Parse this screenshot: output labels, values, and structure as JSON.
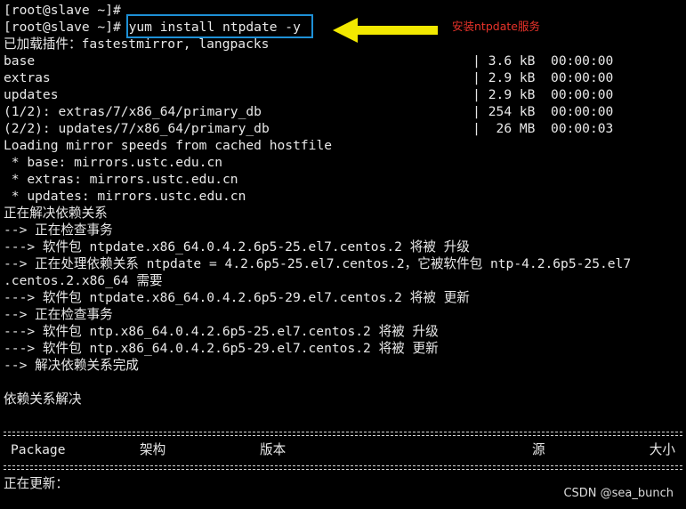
{
  "annotation": {
    "text": "安装ntpdate服务",
    "text_color": "#e8332a",
    "arrow_color": "#f2e800",
    "box_color": "#1e90d6"
  },
  "terminal": {
    "lines": [
      "[root@slave ~]#",
      "[root@slave ~]# yum install ntpdate -y",
      "已加载插件：fastestmirror, langpacks",
      "base                                                        | 3.6 kB  00:00:00",
      "extras                                                      | 2.9 kB  00:00:00",
      "updates                                                     | 2.9 kB  00:00:00",
      "(1/2): extras/7/x86_64/primary_db                           | 254 kB  00:00:00",
      "(2/2): updates/7/x86_64/primary_db                          |  26 MB  00:00:03",
      "Loading mirror speeds from cached hostfile",
      " * base: mirrors.ustc.edu.cn",
      " * extras: mirrors.ustc.edu.cn",
      " * updates: mirrors.ustc.edu.cn",
      "正在解决依赖关系",
      "--> 正在检查事务",
      "---> 软件包 ntpdate.x86_64.0.4.2.6p5-25.el7.centos.2 将被 升级",
      "--> 正在处理依赖关系 ntpdate = 4.2.6p5-25.el7.centos.2，它被软件包 ntp-4.2.6p5-25.el7",
      ".centos.2.x86_64 需要",
      "---> 软件包 ntpdate.x86_64.0.4.2.6p5-29.el7.centos.2 将被 更新",
      "--> 正在检查事务",
      "---> 软件包 ntp.x86_64.0.4.2.6p5-25.el7.centos.2 将被 升级",
      "---> 软件包 ntp.x86_64.0.4.2.6p5-29.el7.centos.2 将被 更新",
      "--> 解决依赖关系完成",
      "",
      "依赖关系解决",
      ""
    ],
    "table_header": {
      "package": "Package",
      "arch": "架构",
      "version": "版本",
      "repo": "源",
      "size": "大小"
    },
    "last_line": "正在更新："
  },
  "watermark": "CSDN @sea_bunch"
}
